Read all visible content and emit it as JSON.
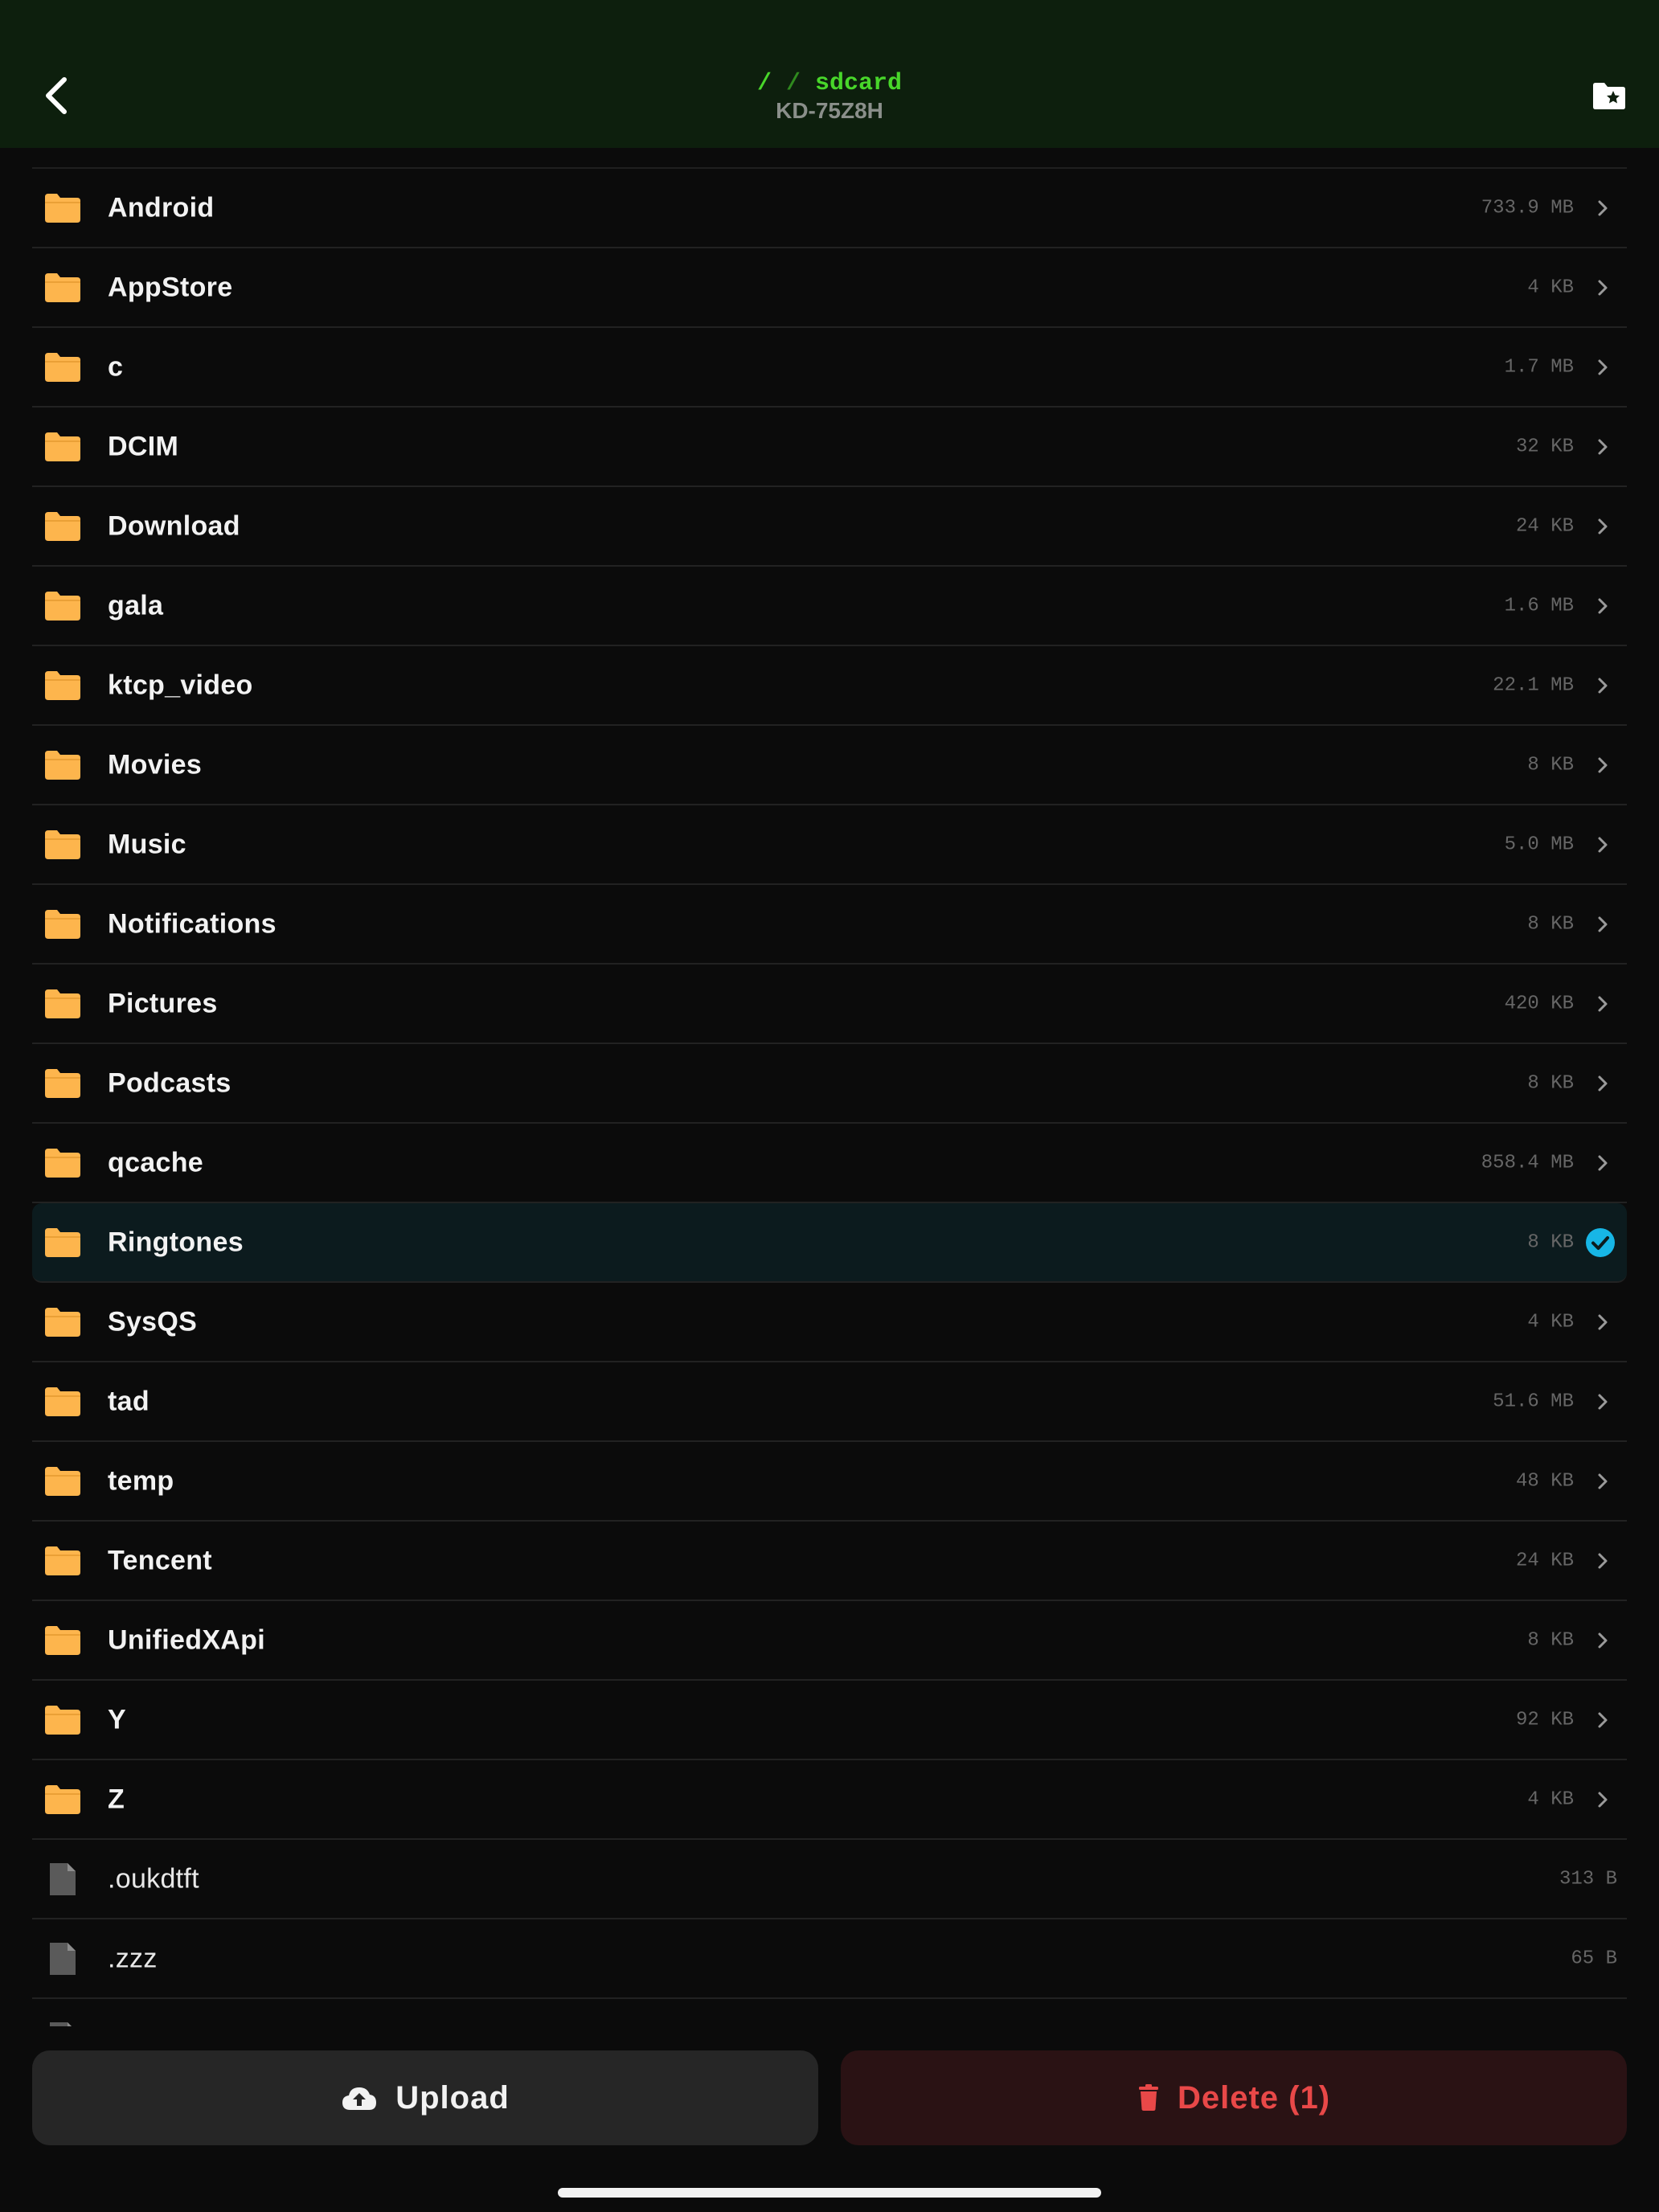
{
  "header": {
    "path_root": "/",
    "path_sep": "/",
    "path_current": "sdcard",
    "device": "KD-75Z8H"
  },
  "colors": {
    "folder": "#fdb54d",
    "file": "#5a5a5a",
    "accent_green": "#48d62a",
    "selected_check": "#17b6e6",
    "delete_red": "#e84848"
  },
  "icons": {
    "back": "chevron-left-icon",
    "bookmark": "folder-star-icon",
    "folder": "folder-icon",
    "file": "file-icon",
    "chevron": "chevron-right-icon",
    "selected": "check-circle-icon",
    "upload": "cloud-upload-icon",
    "delete": "trash-icon"
  },
  "items": [
    {
      "name": "Android",
      "size": "733.9 MB",
      "type": "folder"
    },
    {
      "name": "AppStore",
      "size": "4 KB",
      "type": "folder"
    },
    {
      "name": "c",
      "size": "1.7 MB",
      "type": "folder"
    },
    {
      "name": "DCIM",
      "size": "32 KB",
      "type": "folder"
    },
    {
      "name": "Download",
      "size": "24 KB",
      "type": "folder"
    },
    {
      "name": "gala",
      "size": "1.6 MB",
      "type": "folder"
    },
    {
      "name": "ktcp_video",
      "size": "22.1 MB",
      "type": "folder"
    },
    {
      "name": "Movies",
      "size": "8 KB",
      "type": "folder"
    },
    {
      "name": "Music",
      "size": "5.0 MB",
      "type": "folder"
    },
    {
      "name": "Notifications",
      "size": "8 KB",
      "type": "folder"
    },
    {
      "name": "Pictures",
      "size": "420 KB",
      "type": "folder"
    },
    {
      "name": "Podcasts",
      "size": "8 KB",
      "type": "folder"
    },
    {
      "name": "qcache",
      "size": "858.4 MB",
      "type": "folder"
    },
    {
      "name": "Ringtones",
      "size": "8 KB",
      "type": "folder",
      "selected": true
    },
    {
      "name": "SysQS",
      "size": "4 KB",
      "type": "folder"
    },
    {
      "name": "tad",
      "size": "51.6 MB",
      "type": "folder"
    },
    {
      "name": "temp",
      "size": "48 KB",
      "type": "folder"
    },
    {
      "name": "Tencent",
      "size": "24 KB",
      "type": "folder"
    },
    {
      "name": "UnifiedXApi",
      "size": "8 KB",
      "type": "folder"
    },
    {
      "name": "Y",
      "size": "92 KB",
      "type": "folder"
    },
    {
      "name": "Z",
      "size": "4 KB",
      "type": "folder"
    },
    {
      "name": ".oukdtft",
      "size": "313 B",
      "type": "file"
    },
    {
      "name": ".zzz",
      "size": "65 B",
      "type": "file"
    },
    {
      "name": "",
      "size": "",
      "type": "file"
    }
  ],
  "footer": {
    "upload_label": "Upload",
    "delete_label": "Delete (1)"
  }
}
